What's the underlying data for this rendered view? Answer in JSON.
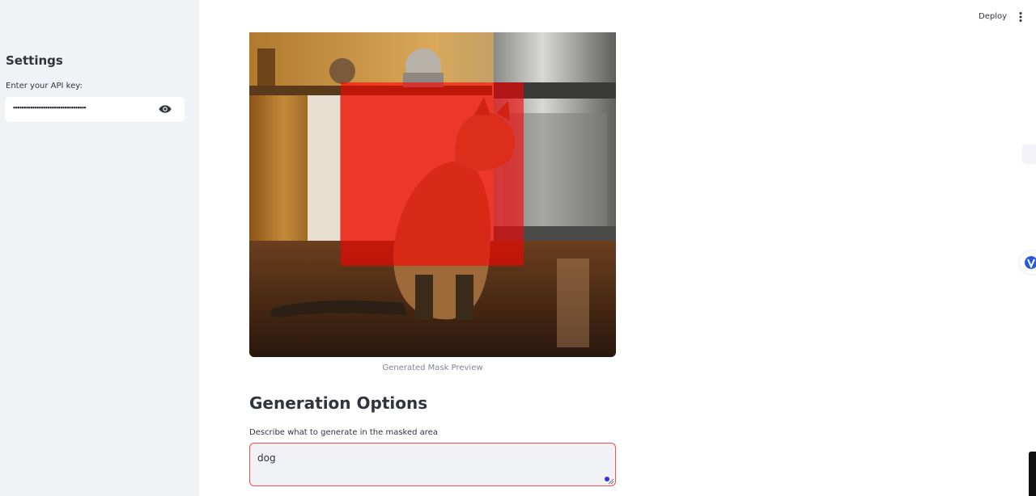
{
  "sidebar": {
    "title": "Settings",
    "api_key_label": "Enter your API key:",
    "api_key_value": "••••••••••••••••••••••••••••••••••"
  },
  "header": {
    "deploy_label": "Deploy"
  },
  "main": {
    "image_caption": "Generated Mask Preview",
    "section_heading": "Generation Options",
    "prompt_label": "Describe what to generate in the masked area",
    "prompt_value": "dog"
  },
  "icons": {
    "visibility": "eye-icon",
    "menu": "kebab-menu-icon"
  },
  "colors": {
    "sidebar_bg": "#f0f2f6",
    "accent_red": "#ff4b4b",
    "caption_gray": "#808495",
    "mask_overlay": "#ff0000"
  }
}
